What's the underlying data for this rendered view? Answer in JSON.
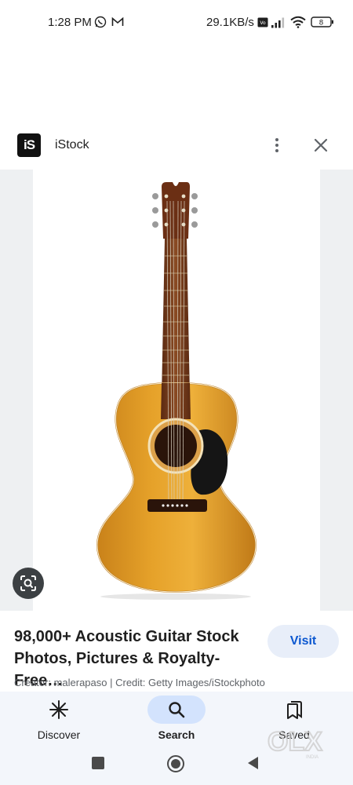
{
  "status_bar": {
    "time": "1:28 PM",
    "network_speed": "29.1KB/s",
    "battery_level": "8",
    "icons": [
      "whatsapp-icon",
      "gmail-icon",
      "volte-icon",
      "signal-icon",
      "wifi-icon",
      "battery-icon"
    ]
  },
  "source": {
    "logo_text": "iS",
    "name": "iStock"
  },
  "result": {
    "title": "98,000+ Acoustic Guitar Stock Photos, Pictures & Royalty-Free…",
    "visit_label": "Visit",
    "credit": "Creator: malerapaso | Credit: Getty Images/iStockphoto"
  },
  "bottom_nav": {
    "items": [
      {
        "label": "Discover",
        "icon": "discover-icon",
        "active": false
      },
      {
        "label": "Search",
        "icon": "search-icon",
        "active": true
      },
      {
        "label": "Saved",
        "icon": "saved-icon",
        "active": false
      }
    ]
  },
  "system_nav": [
    "recent-apps-icon",
    "home-icon",
    "back-icon"
  ],
  "watermark": {
    "text": "OLX",
    "subtext": "INDIA"
  },
  "colors": {
    "accent": "#0b57d0",
    "visit_bg": "#e8eef9",
    "nav_bg": "#f3f6fb",
    "active_pill": "#d3e3fd"
  }
}
